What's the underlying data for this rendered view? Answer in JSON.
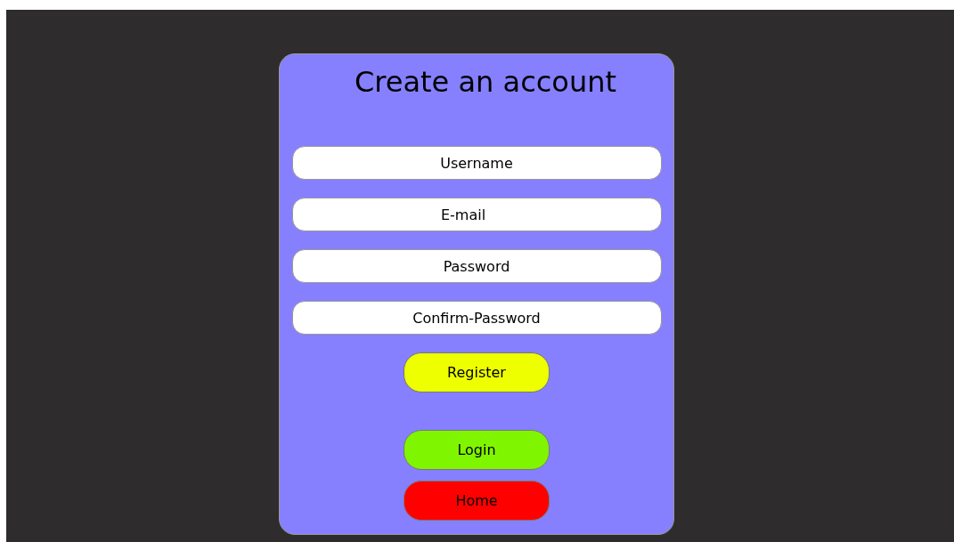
{
  "title": "Create an account",
  "fields": [
    {
      "placeholder": "Username"
    },
    {
      "placeholder": "E-mail"
    },
    {
      "placeholder": "Password"
    },
    {
      "placeholder": "Confirm-Password"
    }
  ],
  "buttons": [
    {
      "label": "Register",
      "color": "#eeff00"
    },
    {
      "label": "Login",
      "color": "#80f500"
    },
    {
      "label": "Home",
      "color": "#ff0000"
    }
  ]
}
